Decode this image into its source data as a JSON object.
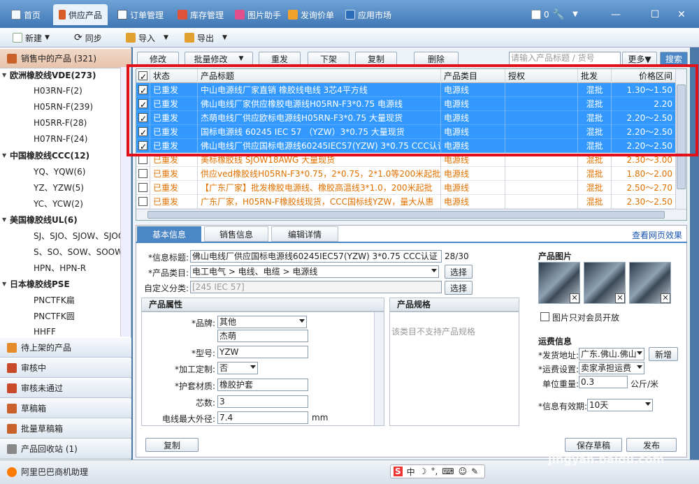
{
  "app": {
    "tabs": [
      {
        "label": "首页",
        "icon": "home-icon"
      },
      {
        "label": "供应产品",
        "icon": "product-icon"
      },
      {
        "label": "订单管理",
        "icon": "order-icon"
      },
      {
        "label": "库存管理",
        "icon": "inventory-icon"
      },
      {
        "label": "图片助手",
        "icon": "image-icon"
      },
      {
        "label": "发询价单",
        "icon": "inquiry-icon"
      },
      {
        "label": "应用市场",
        "icon": "apps-icon"
      }
    ],
    "mail_count": "0",
    "status_title": "阿里巴巴商机助理",
    "colors": {
      "selected_row": "#3399ff",
      "highlight_border": "#e21018",
      "accent_orange": "#e07000"
    }
  },
  "toolbar": {
    "new_label": "新建",
    "sync_label": "同步",
    "import_label": "导入",
    "export_label": "导出"
  },
  "sidebar": {
    "top_title": "销售中的产品 (321)",
    "categories": [
      {
        "label": "欧洲橡胶线VDE(273)",
        "items": [
          "H03RN-F(2)",
          "H05RN-F(239)",
          "H05RR-F(28)",
          "H07RN-F(24)"
        ]
      },
      {
        "label": "中国橡胶线CCC(12)",
        "items": [
          "YQ、YQW(6)",
          "YZ、YZW(5)",
          "YC、YCW(2)"
        ]
      },
      {
        "label": "美国橡胶线UL(6)",
        "items": [
          "SJ、SJO、SJOW、SJOOW",
          "S、SO、SOW、SOOW",
          "HPN、HPN-R"
        ]
      },
      {
        "label": "日本橡胶线PSE",
        "items": [
          "PNCTFK扁",
          "PNCTFK圆",
          "HHFF"
        ]
      }
    ],
    "sections": [
      "待上架的产品",
      "审核中",
      "审核未通过",
      "草稿箱",
      "批量草稿箱",
      "产品回收站 (1)"
    ]
  },
  "actions": {
    "buttons": [
      "修改",
      "批量修改",
      "重发",
      "下架",
      "复制",
      "删除"
    ],
    "search_placeholder": "请输入产品标题 / 货号",
    "more_label": "更多▼",
    "search_label": "搜索"
  },
  "grid": {
    "headers": [
      "状态",
      "产品标题",
      "产品类目",
      "授权",
      "批发",
      "价格区间"
    ],
    "rows": [
      {
        "status": "已重发",
        "title": "中山电源线厂家直销 橡胶线电线 3芯4平方线",
        "category": "电源线",
        "auth": "",
        "wholesale": "混批",
        "price": "1.30～1.50",
        "checked": true,
        "selected": true
      },
      {
        "status": "已重发",
        "title": "佛山电线厂家供应橡胶电源线H05RN-F3*0.75 电源线",
        "category": "电源线",
        "auth": "",
        "wholesale": "混批",
        "price": "2.20",
        "checked": true,
        "selected": true
      },
      {
        "status": "已重发",
        "title": "杰萌电线厂供应欧标电源线H05RN-F3*0.75 大量现货",
        "category": "电源线",
        "auth": "",
        "wholesale": "混批",
        "price": "2.20～2.50",
        "checked": true,
        "selected": true
      },
      {
        "status": "已重发",
        "title": "国标电源线 60245 IEC 57 （YZW）3*0.75 大量现货",
        "category": "电源线",
        "auth": "",
        "wholesale": "混批",
        "price": "2.20～2.50",
        "checked": true,
        "selected": true
      },
      {
        "status": "已重发",
        "title": "佛山电线厂供应国标电源线60245IEC57(YZW) 3*0.75 CCC认证",
        "category": "电源线",
        "auth": "",
        "wholesale": "混批",
        "price": "2.20～2.50",
        "checked": true,
        "selected": true
      },
      {
        "status": "已重发",
        "title": "美标橡胶线 SJOW18AWG 大量现货",
        "category": "电源线",
        "auth": "",
        "wholesale": "混批",
        "price": "2.30～3.00",
        "checked": false,
        "selected": false
      },
      {
        "status": "已重发",
        "title": "供应ved橡胶线H05RN-F3*0.75，2*0.75，2*1.0等200米起批",
        "category": "电源线",
        "auth": "",
        "wholesale": "混批",
        "price": "1.80～2.00",
        "checked": false,
        "selected": false
      },
      {
        "status": "已重发",
        "title": "【广东厂家】批发橡胶电源线、橡胶高温线3*1.0，200米起批",
        "category": "电源线",
        "auth": "",
        "wholesale": "混批",
        "price": "2.50～2.70",
        "checked": false,
        "selected": false
      },
      {
        "status": "已重发",
        "title": "广东厂家，H05RN-F橡胶线现货，CCC国标线YZW，量大从惠",
        "category": "电源线",
        "auth": "",
        "wholesale": "混批",
        "price": "2.30～2.50",
        "checked": false,
        "selected": false
      }
    ]
  },
  "detail": {
    "tabs": [
      "基本信息",
      "销售信息",
      "编辑详情"
    ],
    "view_link": "查看网页效果",
    "info_title_label": "*信息标题:",
    "info_title_value": "佛山电线厂供应国标电源线60245IEC57(YZW) 3*0.75  CCC认证",
    "title_count": "28/30",
    "category_label": "*产品类目:",
    "category_value": "电工电气 > 电线、电缆 > 电源线",
    "select_label": "选择",
    "custom_label": "自定义分类:",
    "custom_value": "[245 IEC 57]",
    "attr_head": "产品属性",
    "spec_head": "产品规格",
    "spec_note": "该类目不支持产品规格",
    "brand_label": "*品牌:",
    "brand_value": "其他",
    "brand_text": "杰萌",
    "model_label": "*型号:",
    "model_value": "YZW",
    "custom_made_label": "*加工定制:",
    "custom_made_value": "否",
    "sheath_label": "*护套材质:",
    "sheath_value": "橡胶护套",
    "cores_label": "芯数:",
    "cores_value": "3",
    "diameter_label": "电线最大外径:",
    "diameter_value": "7.4",
    "diameter_unit": "mm",
    "images_head": "产品图片",
    "members_only": "图片只对会员开放",
    "shipping_head": "运费信息",
    "ship_from_label": "*发货地址:",
    "ship_from_value": "广东.佛山.佛山",
    "add_label": "新增",
    "freight_label": "*运费设置:",
    "freight_value": "卖家承担运费",
    "unit_weight_label": "单位重量:",
    "unit_weight_value": "0.3",
    "unit_weight_unit": "公斤/米",
    "validity_label": "*信息有效期:",
    "validity_value": "10天",
    "copy_label": "复制",
    "save_draft_label": "保存草稿",
    "publish_label": "发布"
  },
  "watermark": {
    "line1": "Bai",
    "line2": "经验",
    "line3": "jingyan.baidu.com"
  }
}
